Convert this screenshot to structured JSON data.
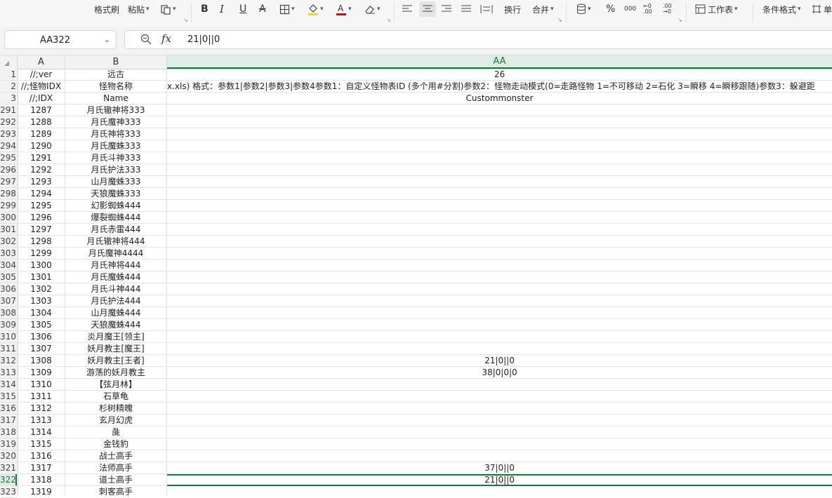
{
  "ribbon": {
    "format_painter": "格式刷",
    "paste": "粘贴",
    "wrap": "换行",
    "merge": "合并",
    "worksheet": "工作表",
    "cond_format": "条件格式",
    "more": "单",
    "percent": "%",
    "thousands": "000",
    "dec_inc": "←0 .00",
    "dec_dec": ".00 →0",
    "font_color": "#e00000",
    "fill_color": "#f2e100",
    "accent": "#217346"
  },
  "formula_bar": {
    "name_box": "AA322",
    "fx_label": "fx",
    "value": "21|0||0"
  },
  "columns": {
    "a": "A",
    "b": "B",
    "aa": "AA"
  },
  "rows": [
    {
      "n": "1",
      "a": "//;ver",
      "b": "远古",
      "aa": "26"
    },
    {
      "n": "2",
      "a": "//;怪物IDX",
      "b": "怪物名称",
      "aa": "x.xls) 格式：参数1|参数2|参数3|参数4参数1：自定义怪物表ID (多个用#分割)参数2：怪物走动模式(0=走路怪物 1=不可移动 2=石化 3=瞬移 4=瞬移跟随)参数3：躲避距"
    },
    {
      "n": "3",
      "a": "//;IDX",
      "b": "Name",
      "aa": "Custommonster"
    },
    {
      "n": "291",
      "a": "1287",
      "b": "月氏辙神将333",
      "aa": ""
    },
    {
      "n": "292",
      "a": "1288",
      "b": "月氏魔神333",
      "aa": ""
    },
    {
      "n": "293",
      "a": "1289",
      "b": "月氏神将333",
      "aa": ""
    },
    {
      "n": "294",
      "a": "1290",
      "b": "月氏魔蛛333",
      "aa": ""
    },
    {
      "n": "295",
      "a": "1291",
      "b": "月氏斗神333",
      "aa": ""
    },
    {
      "n": "296",
      "a": "1292",
      "b": "月氏护法333",
      "aa": ""
    },
    {
      "n": "297",
      "a": "1293",
      "b": "山月魔蛛333",
      "aa": ""
    },
    {
      "n": "298",
      "a": "1294",
      "b": "天狼魔蛛333",
      "aa": ""
    },
    {
      "n": "299",
      "a": "1295",
      "b": "幻影蜘蛛444",
      "aa": ""
    },
    {
      "n": "300",
      "a": "1296",
      "b": "爆裂蜘蛛444",
      "aa": ""
    },
    {
      "n": "301",
      "a": "1297",
      "b": "月氏赤雷444",
      "aa": ""
    },
    {
      "n": "302",
      "a": "1298",
      "b": "月氏辙神将444",
      "aa": ""
    },
    {
      "n": "303",
      "a": "1299",
      "b": "月氏魔神4444",
      "aa": ""
    },
    {
      "n": "304",
      "a": "1300",
      "b": "月氏神将444",
      "aa": ""
    },
    {
      "n": "305",
      "a": "1301",
      "b": "月氏魔蛛444",
      "aa": ""
    },
    {
      "n": "306",
      "a": "1302",
      "b": "月氏斗神444",
      "aa": ""
    },
    {
      "n": "307",
      "a": "1303",
      "b": "月氏护法444",
      "aa": ""
    },
    {
      "n": "308",
      "a": "1304",
      "b": "山月魔蛛444",
      "aa": ""
    },
    {
      "n": "309",
      "a": "1305",
      "b": "天狼魔蛛444",
      "aa": ""
    },
    {
      "n": "310",
      "a": "1306",
      "b": "炎月魔王[领主]",
      "aa": ""
    },
    {
      "n": "311",
      "a": "1307",
      "b": "妖月教主[魔王]",
      "aa": ""
    },
    {
      "n": "312",
      "a": "1308",
      "b": "妖月教主[王者]",
      "aa": "21|0||0"
    },
    {
      "n": "313",
      "a": "1309",
      "b": "游荡的妖月教主",
      "aa": "38|0|0|0"
    },
    {
      "n": "314",
      "a": "1310",
      "b": "【弦月林】",
      "aa": ""
    },
    {
      "n": "315",
      "a": "1311",
      "b": "石草龟",
      "aa": ""
    },
    {
      "n": "316",
      "a": "1312",
      "b": "杉树精魄",
      "aa": ""
    },
    {
      "n": "317",
      "a": "1313",
      "b": "玄月幻虎",
      "aa": ""
    },
    {
      "n": "318",
      "a": "1314",
      "b": "彘",
      "aa": ""
    },
    {
      "n": "319",
      "a": "1315",
      "b": "金钱豹",
      "aa": ""
    },
    {
      "n": "320",
      "a": "1316",
      "b": "战士高手",
      "aa": ""
    },
    {
      "n": "321",
      "a": "1317",
      "b": "法师高手",
      "aa": "37|0||0"
    },
    {
      "n": "322",
      "a": "1318",
      "b": "道士高手",
      "aa": "21|0||0"
    },
    {
      "n": "323",
      "a": "1319",
      "b": "刺客高手",
      "aa": ""
    }
  ],
  "active_row": "322"
}
